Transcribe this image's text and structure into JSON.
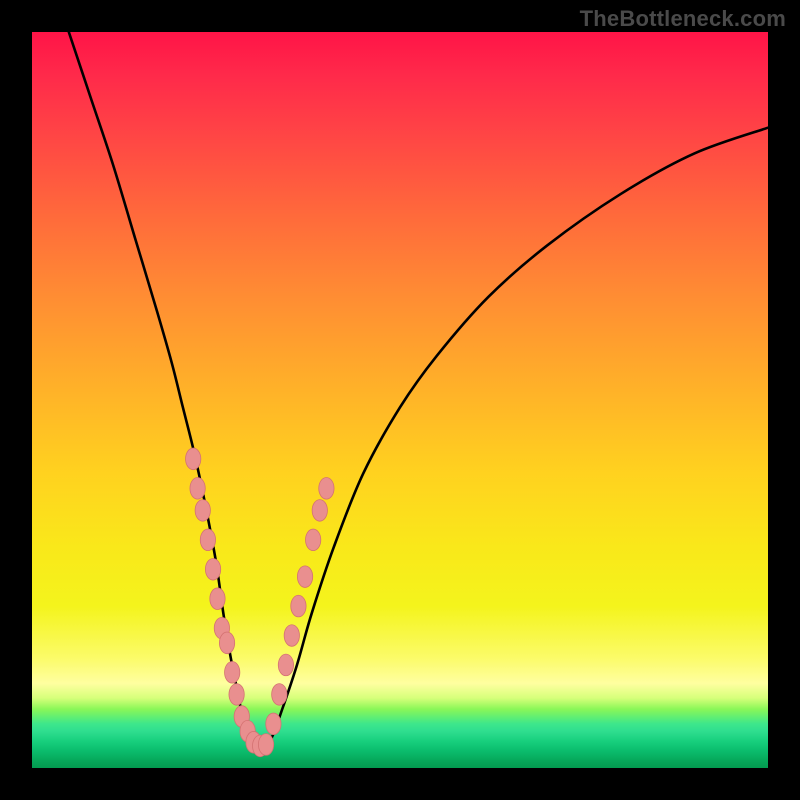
{
  "watermark": {
    "text": "TheBottleneck.com"
  },
  "colors": {
    "curve": "#000000",
    "marker_fill": "#e98f8f",
    "marker_stroke": "#d47272"
  },
  "chart_data": {
    "type": "line",
    "title": "",
    "xlabel": "",
    "ylabel": "",
    "xlim": [
      0,
      100
    ],
    "ylim": [
      0,
      100
    ],
    "grid": false,
    "legend": false,
    "series": [
      {
        "name": "bottleneck-curve",
        "x": [
          5,
          8,
          11,
          14,
          17,
          19,
          20.5,
          22,
          23.5,
          25,
          26,
          27,
          28,
          29,
          30,
          31,
          32.5,
          34,
          36,
          38,
          41,
          45,
          50,
          55,
          62,
          70,
          80,
          90,
          100
        ],
        "y": [
          100,
          91,
          82,
          72,
          62,
          55,
          49,
          43,
          36,
          28,
          21,
          15,
          10,
          5,
          2.5,
          2.5,
          4,
          8,
          14,
          21,
          30,
          40,
          49,
          56,
          64,
          71,
          78,
          83.5,
          87
        ]
      }
    ],
    "markers": [
      {
        "name": "cluster-left",
        "x": [
          21.9,
          22.5,
          23.2,
          23.9,
          24.6,
          25.2,
          25.8,
          26.5,
          27.2,
          27.8,
          28.5,
          29.3,
          30.1,
          31.0,
          31.8
        ],
        "y": [
          42,
          38,
          35,
          31,
          27,
          23,
          19,
          17,
          13,
          10,
          7,
          5,
          3.5,
          3,
          3.2
        ]
      },
      {
        "name": "cluster-right",
        "x": [
          32.8,
          33.6,
          34.5,
          35.3,
          36.2,
          37.1,
          38.2,
          39.1,
          40.0
        ],
        "y": [
          6,
          10,
          14,
          18,
          22,
          26,
          31,
          35,
          38
        ]
      }
    ],
    "marker_size": 9,
    "note": "Values are approximate, read from the plotted pixels; axes carry no tick labels in the original."
  }
}
